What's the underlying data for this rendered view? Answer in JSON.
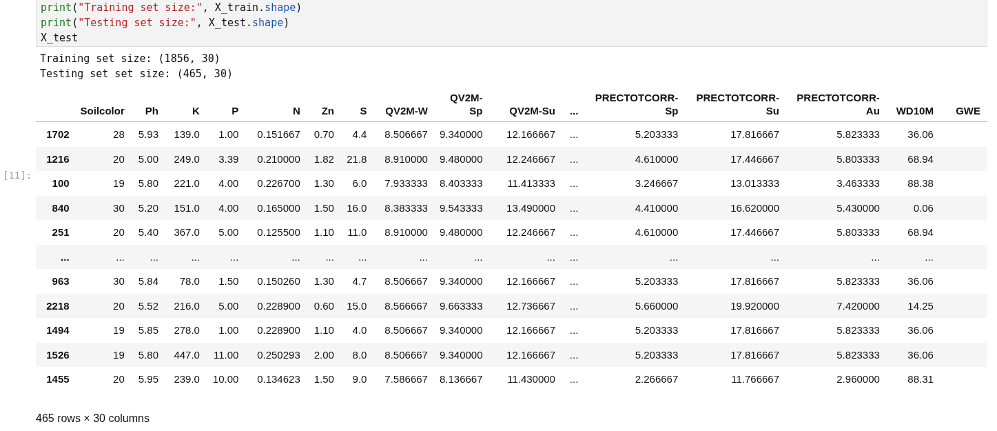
{
  "code_cell": {
    "lines": [
      [
        {
          "kind": "builtin",
          "text": "print"
        },
        {
          "kind": "plain",
          "text": "("
        },
        {
          "kind": "string",
          "text": "\"Training set size:\""
        },
        {
          "kind": "plain",
          "text": ", X_train."
        },
        {
          "kind": "attr",
          "text": "shape"
        },
        {
          "kind": "plain",
          "text": ")"
        }
      ],
      [
        {
          "kind": "builtin",
          "text": "print"
        },
        {
          "kind": "plain",
          "text": "("
        },
        {
          "kind": "string",
          "text": "\"Testing set size:\""
        },
        {
          "kind": "plain",
          "text": ", X_test."
        },
        {
          "kind": "attr",
          "text": "shape"
        },
        {
          "kind": "plain",
          "text": ")"
        }
      ],
      [
        {
          "kind": "plain",
          "text": "X_test"
        }
      ]
    ]
  },
  "stdout": [
    "Training set size: (1856, 30)",
    "Testing set set size: (465, 30)"
  ],
  "execution_count": "[11]:",
  "table": {
    "columns": [
      "Soilcolor",
      "Ph",
      "K",
      "P",
      "N",
      "Zn",
      "S",
      "QV2M-W",
      "QV2M-Sp",
      "QV2M-Su",
      "...",
      "PRECTOTCORR-Sp",
      "PRECTOTCORR-Su",
      "PRECTOTCORR-Au",
      "WD10M",
      "GWE"
    ],
    "rows": [
      {
        "index": "1702",
        "cells": [
          "28",
          "5.93",
          "139.0",
          "1.00",
          "0.151667",
          "0.70",
          "4.4",
          "8.506667",
          "9.340000",
          "12.166667",
          "...",
          "5.203333",
          "17.816667",
          "5.823333",
          "36.06"
        ]
      },
      {
        "index": "1216",
        "cells": [
          "20",
          "5.00",
          "249.0",
          "3.39",
          "0.210000",
          "1.82",
          "21.8",
          "8.910000",
          "9.480000",
          "12.246667",
          "...",
          "4.610000",
          "17.446667",
          "5.803333",
          "68.94"
        ]
      },
      {
        "index": "100",
        "cells": [
          "19",
          "5.80",
          "221.0",
          "4.00",
          "0.226700",
          "1.30",
          "6.0",
          "7.933333",
          "8.403333",
          "11.413333",
          "...",
          "3.246667",
          "13.013333",
          "3.463333",
          "88.38"
        ]
      },
      {
        "index": "840",
        "cells": [
          "30",
          "5.20",
          "151.0",
          "4.00",
          "0.165000",
          "1.50",
          "16.0",
          "8.383333",
          "9.543333",
          "13.490000",
          "...",
          "4.410000",
          "16.620000",
          "5.430000",
          "0.06"
        ]
      },
      {
        "index": "251",
        "cells": [
          "20",
          "5.40",
          "367.0",
          "5.00",
          "0.125500",
          "1.10",
          "11.0",
          "8.910000",
          "9.480000",
          "12.246667",
          "...",
          "4.610000",
          "17.446667",
          "5.803333",
          "68.94"
        ]
      },
      {
        "index": "...",
        "cells": [
          "...",
          "...",
          "...",
          "...",
          "...",
          "...",
          "...",
          "...",
          "...",
          "...",
          "...",
          "...",
          "...",
          "...",
          "..."
        ]
      },
      {
        "index": "963",
        "cells": [
          "30",
          "5.84",
          "78.0",
          "1.50",
          "0.150260",
          "1.30",
          "4.7",
          "8.506667",
          "9.340000",
          "12.166667",
          "...",
          "5.203333",
          "17.816667",
          "5.823333",
          "36.06"
        ]
      },
      {
        "index": "2218",
        "cells": [
          "20",
          "5.52",
          "216.0",
          "5.00",
          "0.228900",
          "0.60",
          "15.0",
          "8.566667",
          "9.663333",
          "12.736667",
          "...",
          "5.660000",
          "19.920000",
          "7.420000",
          "14.25"
        ]
      },
      {
        "index": "1494",
        "cells": [
          "19",
          "5.85",
          "278.0",
          "1.00",
          "0.228900",
          "1.10",
          "4.0",
          "8.506667",
          "9.340000",
          "12.166667",
          "...",
          "5.203333",
          "17.816667",
          "5.823333",
          "36.06"
        ]
      },
      {
        "index": "1526",
        "cells": [
          "19",
          "5.80",
          "447.0",
          "11.00",
          "0.250293",
          "2.00",
          "8.0",
          "8.506667",
          "9.340000",
          "12.166667",
          "...",
          "5.203333",
          "17.816667",
          "5.823333",
          "36.06"
        ]
      },
      {
        "index": "1455",
        "cells": [
          "20",
          "5.95",
          "239.0",
          "10.00",
          "0.134623",
          "1.50",
          "9.0",
          "7.586667",
          "8.136667",
          "11.430000",
          "...",
          "2.266667",
          "11.766667",
          "2.960000",
          "88.31"
        ]
      }
    ]
  },
  "footer": "465 rows × 30 columns"
}
